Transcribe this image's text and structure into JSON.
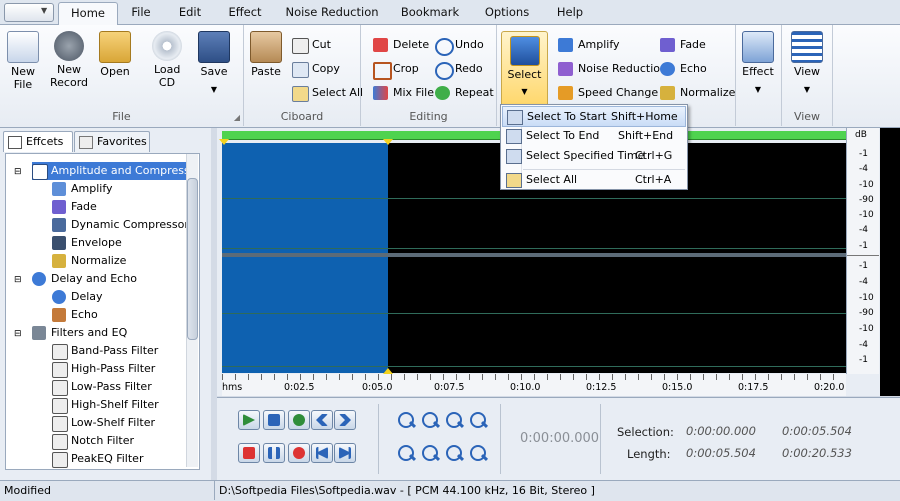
{
  "ribbon_tabs": [
    "Home",
    "File",
    "Edit",
    "Effect",
    "Noise Reduction",
    "Bookmark",
    "Options",
    "Help"
  ],
  "active_tab": "Home",
  "groups": {
    "file": {
      "label": "File",
      "new_file": "New File",
      "new_record": "New Record",
      "open": "Open",
      "load_cd": "Load CD",
      "save": "Save"
    },
    "clipboard": {
      "label": "Ciboard",
      "paste": "Paste",
      "cut": "Cut",
      "copy": "Copy",
      "select_all": "Select All"
    },
    "editing": {
      "label": "Editing",
      "delete": "Delete",
      "crop": "Crop",
      "mix_file": "Mix File",
      "undo": "Undo",
      "redo": "Redo",
      "repeat": "Repeat"
    },
    "select": {
      "label": "Select"
    },
    "effects": {
      "amplify": "Amplify",
      "noise_reduction": "Noise Reduction",
      "speed_change": "Speed Change",
      "fade": "Fade",
      "echo": "Echo",
      "normalize": "Normalize",
      "effect": "Effect"
    },
    "view": {
      "label": "View",
      "view": "View"
    }
  },
  "select_menu": [
    {
      "label": "Select To Start",
      "shortcut": "Shift+Home"
    },
    {
      "label": "Select To End",
      "shortcut": "Shift+End"
    },
    {
      "label": "Select Specified Time",
      "shortcut": "Ctrl+G"
    },
    {
      "label": "Select All",
      "shortcut": "Ctrl+A"
    }
  ],
  "left_tabs": [
    "Effcets",
    "Favorites"
  ],
  "tree": {
    "amplitude": {
      "label": "Amplitude and Compressi",
      "children": [
        "Amplify",
        "Fade",
        "Dynamic Compressor",
        "Envelope",
        "Normalize"
      ]
    },
    "delay": {
      "label": "Delay and Echo",
      "children": [
        "Delay",
        "Echo"
      ]
    },
    "filters": {
      "label": "Filters and EQ",
      "children": [
        "Band-Pass Filter",
        "High-Pass Filter",
        "Low-Pass Filter",
        "High-Shelf Filter",
        "Low-Shelf Filter",
        "Notch Filter",
        "PeakEQ Filter"
      ]
    }
  },
  "db_scale": {
    "unit": "dB",
    "top": [
      "-1",
      "-4",
      "-10",
      "-90",
      "-10",
      "-4",
      "-1"
    ],
    "bottom": [
      "-1",
      "-4",
      "-10",
      "-90",
      "-10",
      "-4",
      "-1"
    ]
  },
  "time_ruler": [
    "hms",
    "0:02.5",
    "0:05.0",
    "0:07.5",
    "0:10.0",
    "0:12.5",
    "0:15.0",
    "0:17.5",
    "0:20.0"
  ],
  "transport": {
    "current_time": "0:00:00.000",
    "selection_label": "Selection:",
    "length_label": "Length:",
    "selection_start": "0:00:00.000",
    "selection_end": "0:00:05.504",
    "length_selection": "0:00:05.504",
    "length_total": "0:00:20.533"
  },
  "status": {
    "left": "Modified",
    "right": "D:\\Softpedia Files\\Softpedia.wav - [ PCM 44.100 kHz, 16 Bit, Stereo ]"
  },
  "colors": {
    "selection": "#0e61b0",
    "waveform_bg": "#000000",
    "progress": "#4fd34f"
  }
}
